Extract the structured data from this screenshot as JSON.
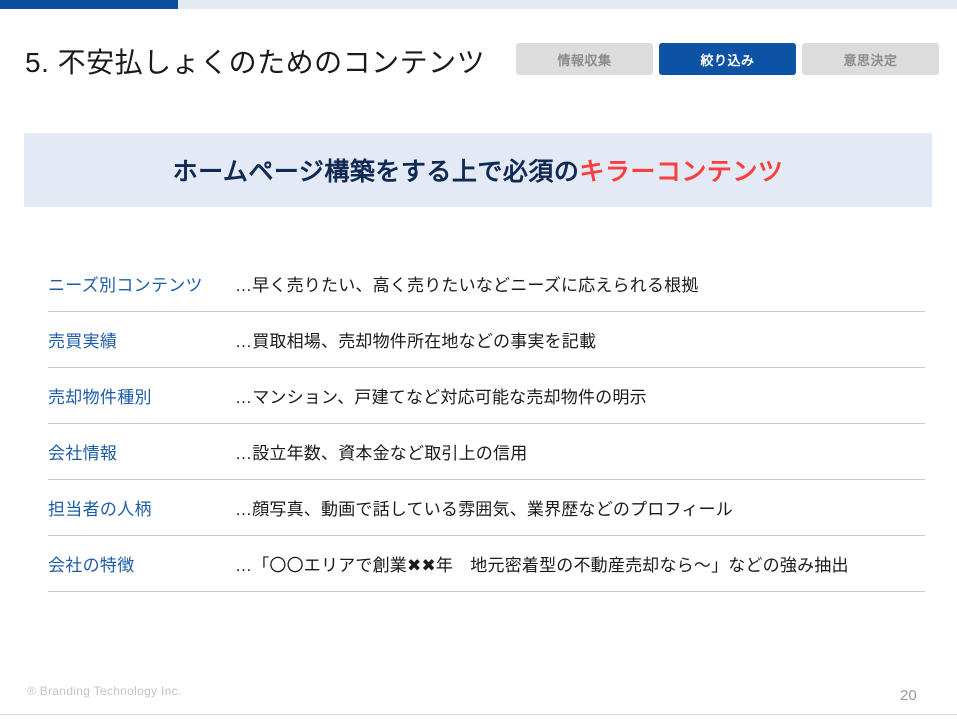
{
  "progress": {
    "filled_percent": 18.6,
    "fill_color": "#084d9e",
    "track_color": "#e4eaf2"
  },
  "header": {
    "title": "5. 不安払しょくのためのコンテンツ",
    "steps": [
      {
        "label": "情報収集",
        "active": false
      },
      {
        "label": "絞り込み",
        "active": true
      },
      {
        "label": "意思決定",
        "active": false
      }
    ],
    "active_step_color": "#0c52a5",
    "inactive_step_color": "#dcdcdc"
  },
  "banner": {
    "text_main": "ホームページ構築をする上で必須の",
    "text_accent": "キラーコンテンツ",
    "background_color": "#e3eaf5",
    "main_color": "#102a54",
    "accent_color": "#f93f3f"
  },
  "content": {
    "label_color": "#1f5ca8",
    "rows": [
      {
        "label": "ニーズ別コンテンツ",
        "desc": "…早く売りたい、高く売りたいなどニーズに応えられる根拠"
      },
      {
        "label": "売買実績",
        "desc": "…買取相場、売却物件所在地などの事実を記載"
      },
      {
        "label": "売却物件種別",
        "desc": "…マンション、戸建てなど対応可能な売却物件の明示"
      },
      {
        "label": "会社情報",
        "desc": "…設立年数、資本金など取引上の信用"
      },
      {
        "label": "担当者の人柄",
        "desc": "…顔写真、動画で話している雰囲気、業界歴などのプロフィール"
      },
      {
        "label": "会社の特徴",
        "desc": "…「〇〇エリアで創業✖✖年　地元密着型の不動産売却なら〜」などの強み抽出"
      }
    ]
  },
  "footer": {
    "copyright": "® Branding Technology Inc.",
    "page_number": "20"
  }
}
